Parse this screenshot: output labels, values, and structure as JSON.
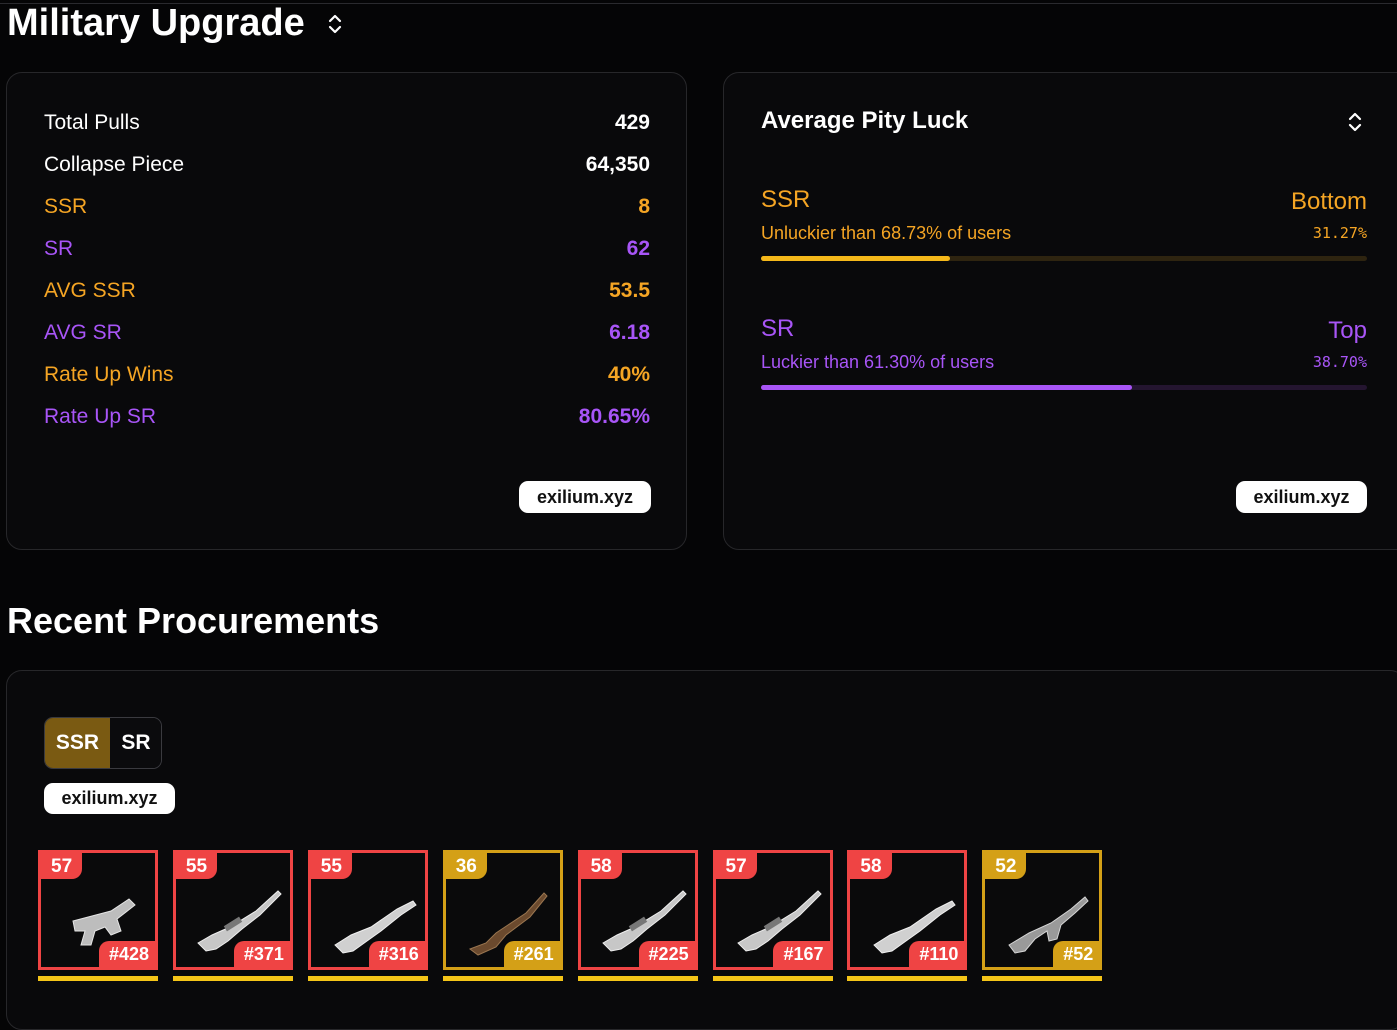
{
  "title": "Military Upgrade",
  "stats": {
    "rows": [
      {
        "label": "Total Pulls",
        "value": "429",
        "tone": "white"
      },
      {
        "label": "Collapse Piece",
        "value": "64,350",
        "tone": "white"
      },
      {
        "label": "SSR",
        "value": "8",
        "tone": "gold"
      },
      {
        "label": "SR",
        "value": "62",
        "tone": "purple"
      },
      {
        "label": "AVG SSR",
        "value": "53.5",
        "tone": "gold"
      },
      {
        "label": "AVG SR",
        "value": "6.18",
        "tone": "purple"
      },
      {
        "label": "Rate Up Wins",
        "value": "40%",
        "tone": "gold"
      },
      {
        "label": "Rate Up SR",
        "value": "80.65%",
        "tone": "purple"
      }
    ],
    "badge": "exilium.xyz"
  },
  "luck": {
    "title": "Average Pity Luck",
    "ssr": {
      "rarity": "SSR",
      "rank": "Bottom",
      "desc": "Unluckier than 68.73% of users",
      "percent_text": "31.27%",
      "fill_fraction": 0.3127
    },
    "sr": {
      "rarity": "SR",
      "rank": "Top",
      "desc": "Luckier than 61.30% of users",
      "percent_text": "38.70%",
      "fill_fraction": 0.613
    },
    "badge": "exilium.xyz"
  },
  "recent": {
    "title": "Recent Procurements",
    "toggle": {
      "ssr": "SSR",
      "sr": "SR",
      "selected": "SSR"
    },
    "badge": "exilium.xyz",
    "items": [
      {
        "pity": "57",
        "number": "#428",
        "color": "red",
        "icon": "smg-icon"
      },
      {
        "pity": "55",
        "number": "#371",
        "color": "red",
        "icon": "sniper-rifle-icon"
      },
      {
        "pity": "55",
        "number": "#316",
        "color": "red",
        "icon": "rifle-icon"
      },
      {
        "pity": "36",
        "number": "#261",
        "color": "gold",
        "icon": "shotgun-icon"
      },
      {
        "pity": "58",
        "number": "#225",
        "color": "red",
        "icon": "sniper-rifle-icon"
      },
      {
        "pity": "57",
        "number": "#167",
        "color": "red",
        "icon": "sniper-rifle-icon"
      },
      {
        "pity": "58",
        "number": "#110",
        "color": "red",
        "icon": "rifle-icon"
      },
      {
        "pity": "52",
        "number": "#52",
        "color": "gold",
        "icon": "assault-rifle-icon"
      }
    ]
  },
  "colors": {
    "gold": "#f5a524",
    "purple": "#a855f7",
    "red": "#ef4444",
    "item_gold": "#d4a017",
    "underline": "#f5c518"
  }
}
